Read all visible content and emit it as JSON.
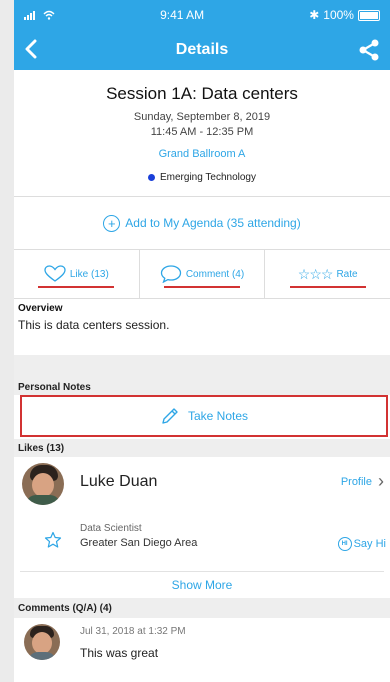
{
  "status_bar": {
    "time": "9:41 AM",
    "battery": "100%"
  },
  "nav": {
    "title": "Details",
    "back_icon": "chevron-left-icon",
    "share_icon": "share-icon"
  },
  "session": {
    "title": "Session 1A: Data centers",
    "date": "Sunday, September 8, 2019",
    "time": "11:45 AM - 12:35 PM",
    "room": "Grand Ballroom A",
    "track": "Emerging Technology"
  },
  "agenda": {
    "label": "Add to My Agenda (35 attending)"
  },
  "actions": {
    "like": "Like (13)",
    "comment": "Comment (4)",
    "rate": "Rate"
  },
  "overview": {
    "heading": "Overview",
    "text": "This is data centers session."
  },
  "notes": {
    "heading": "Personal Notes",
    "button": "Take Notes"
  },
  "likes": {
    "heading": "Likes (13)",
    "person": {
      "name": "Luke Duan",
      "profile": "Profile",
      "job": "Data Scientist",
      "area": "Greater San Diego Area",
      "say_hi": "Say Hi"
    },
    "show_more": "Show More"
  },
  "comments": {
    "heading": "Comments (Q/A) (4)",
    "first": {
      "timestamp": "Jul 31, 2018 at 1:32 PM",
      "text": "This was great"
    }
  },
  "colors": {
    "accent": "#2ea6e6",
    "highlight": "#d23232",
    "track_dot": "#1a3fd9"
  }
}
